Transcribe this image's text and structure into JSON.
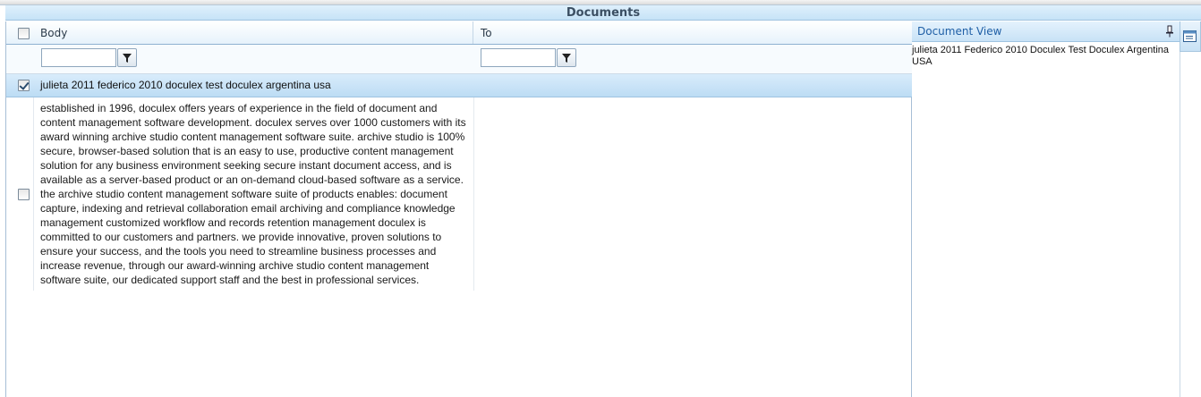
{
  "panel": {
    "title": "Documents"
  },
  "grid": {
    "columns": [
      {
        "label": "Body"
      },
      {
        "label": "To"
      }
    ],
    "group_row": {
      "text": "julieta 2011 federico 2010 doculex test doculex argentina usa",
      "checked": true
    },
    "rows": [
      {
        "checked": false,
        "body_lines": [
          "established in 1996, doculex offers years of experience in the field of document and",
          "content management software development. doculex serves over 1000 customers with its",
          "award winning archive studio content management software suite. archive studio is 100%",
          "secure, browser-based solution that is an easy to use, productive content management",
          "solution for any business environment seeking secure instant document access, and is",
          "available as a server-based product or an on-demand cloud-based software as a service.",
          "the archive studio content management software suite of products enables: document",
          "capture, indexing and retrieval collaboration email archiving and compliance knowledge",
          "management customized workflow and records retention management doculex is",
          "committed to our customers and partners. we provide innovative, proven solutions to",
          "ensure your success, and the tools you need to streamline business processes and",
          "increase revenue, through our award-winning archive studio content management",
          "software suite, our dedicated support staff and the best in professional services."
        ],
        "to": ""
      }
    ]
  },
  "document_view": {
    "title": "Document View",
    "content_lines": [
      "julieta 2011 Federico 2010 Doculex Test Doculex Argentina",
      "USA"
    ]
  },
  "icons": {
    "filter": "funnel-icon",
    "pin": "pin-icon",
    "side_tab": "document-view-tab-icon"
  },
  "colors": {
    "header_gradient_top": "#dff0fc",
    "header_gradient_bottom": "#c6e3f7",
    "group_row": "#c8e2f6",
    "title_text": "#3b4f63",
    "document_view_title": "#1f5fa6"
  }
}
